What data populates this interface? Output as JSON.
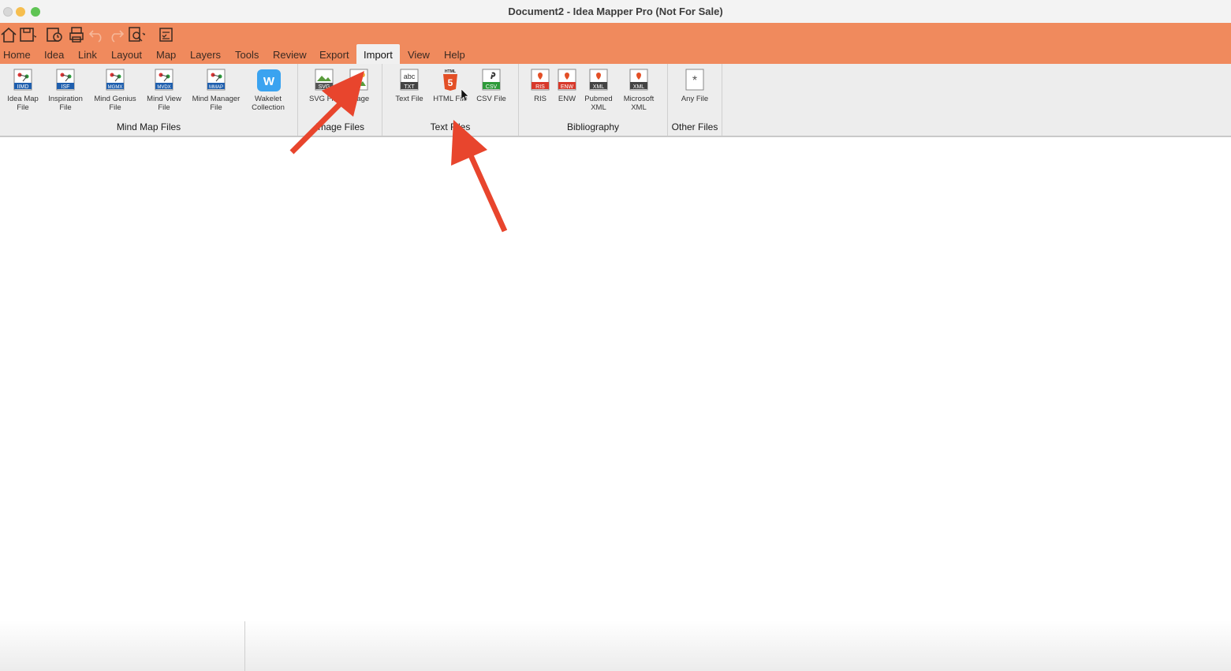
{
  "window": {
    "title": "Document2 - Idea Mapper Pro (Not For Sale)"
  },
  "colors": {
    "accent": "#f08a5d",
    "arrow": "#e8452d",
    "ribbon_bg": "#ededed"
  },
  "quick_access": [
    {
      "name": "home-icon"
    },
    {
      "name": "save-icon"
    },
    {
      "name": "history-icon"
    },
    {
      "name": "print-icon"
    },
    {
      "name": "undo-icon"
    },
    {
      "name": "redo-icon"
    },
    {
      "name": "preview-icon"
    },
    {
      "name": "checklist-icon"
    }
  ],
  "tabs": [
    "Home",
    "Idea",
    "Link",
    "Layout",
    "Map",
    "Layers",
    "Tools",
    "Review",
    "Export",
    "Import",
    "View",
    "Help"
  ],
  "active_tab": "Import",
  "groups": {
    "mind_map": {
      "label": "Mind Map Files",
      "items": [
        {
          "label": "Idea Map File",
          "badge": "IIMD"
        },
        {
          "label": "Inspiration File",
          "badge": "ISF"
        },
        {
          "label": "Mind Genius File",
          "badge": "MGMX"
        },
        {
          "label": "Mind View File",
          "badge": "MVDX"
        },
        {
          "label": "Mind Manager File",
          "badge": "MMAP"
        },
        {
          "label": "Wakelet Collection",
          "badge": "W"
        }
      ]
    },
    "image": {
      "label": "Image Files",
      "items": [
        {
          "label": "SVG File",
          "badge": "SVG"
        },
        {
          "label": "Image",
          "badge": ""
        }
      ]
    },
    "text": {
      "label": "Text Files",
      "items": [
        {
          "label": "Text File",
          "badge": "TXT",
          "top": "abc"
        },
        {
          "label": "HTML File",
          "badge": "5",
          "top": "HTML"
        },
        {
          "label": "CSV File",
          "badge": "CSV"
        }
      ]
    },
    "bibliography": {
      "label": "Bibliography",
      "items": [
        {
          "label": "RIS",
          "badge": "RIS"
        },
        {
          "label": "ENW",
          "badge": "ENW"
        },
        {
          "label": "Pubmed XML",
          "badge": "XML"
        },
        {
          "label": "Microsoft XML",
          "badge": "XML"
        }
      ]
    },
    "other": {
      "label": "Other Files",
      "items": [
        {
          "label": "Any File",
          "badge": "*"
        }
      ]
    }
  }
}
